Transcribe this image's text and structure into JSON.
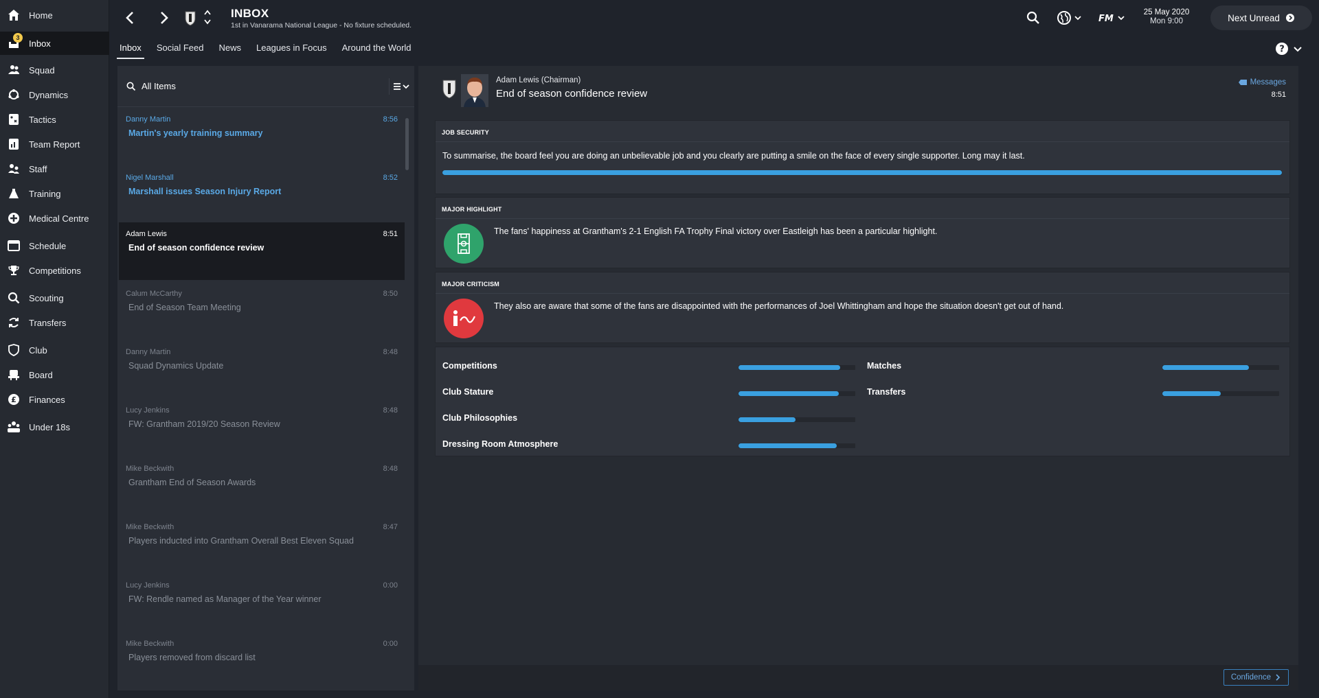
{
  "sidebar": {
    "items": [
      {
        "label": "Home",
        "icon": "home-icon"
      },
      {
        "label": "Inbox",
        "icon": "inbox-icon",
        "badge": "3"
      },
      {
        "label": "Squad",
        "icon": "squad-icon"
      },
      {
        "label": "Dynamics",
        "icon": "dynamics-icon"
      },
      {
        "label": "Tactics",
        "icon": "tactics-icon"
      },
      {
        "label": "Team Report",
        "icon": "team-report-icon"
      },
      {
        "label": "Staff",
        "icon": "staff-icon"
      },
      {
        "label": "Training",
        "icon": "training-icon"
      },
      {
        "label": "Medical Centre",
        "icon": "medical-icon"
      },
      {
        "label": "Schedule",
        "icon": "schedule-icon"
      },
      {
        "label": "Competitions",
        "icon": "trophy-icon"
      },
      {
        "label": "Scouting",
        "icon": "scouting-icon"
      },
      {
        "label": "Transfers",
        "icon": "transfers-icon"
      },
      {
        "label": "Club",
        "icon": "club-icon"
      },
      {
        "label": "Board",
        "icon": "board-icon"
      },
      {
        "label": "Finances",
        "icon": "finances-icon"
      },
      {
        "label": "Under 18s",
        "icon": "under18s-icon"
      }
    ]
  },
  "header": {
    "title": "INBOX",
    "subtitle": "1st in Vanarama National League - No fixture scheduled.",
    "date": "25 May 2020",
    "day_time": "Mon 9:00",
    "next_unread": "Next Unread"
  },
  "tabs": [
    "Inbox",
    "Social Feed",
    "News",
    "Leagues in Focus",
    "Around the World"
  ],
  "list": {
    "filter_label": "All Items",
    "messages": [
      {
        "sender": "Danny Martin",
        "time": "8:56",
        "subject": "Martin's yearly training summary",
        "state": "unread"
      },
      {
        "sender": "Nigel Marshall",
        "time": "8:52",
        "subject": "Marshall issues Season Injury Report",
        "state": "unread"
      },
      {
        "sender": "Adam Lewis",
        "time": "8:51",
        "subject": "End of season confidence review",
        "state": "selected"
      },
      {
        "sender": "Calum McCarthy",
        "time": "8:50",
        "subject": "End of Season Team Meeting",
        "state": "read"
      },
      {
        "sender": "Danny Martin",
        "time": "8:48",
        "subject": "Squad Dynamics Update",
        "state": "read"
      },
      {
        "sender": "Lucy Jenkins",
        "time": "8:48",
        "subject": "FW: Grantham 2019/20 Season Review",
        "state": "read"
      },
      {
        "sender": "Mike Beckwith",
        "time": "8:48",
        "subject": "Grantham End of Season Awards",
        "state": "read"
      },
      {
        "sender": "Mike Beckwith",
        "time": "8:47",
        "subject": "Players inducted into Grantham Overall Best Eleven Squad",
        "state": "read"
      },
      {
        "sender": "Lucy Jenkins",
        "time": "0:00",
        "subject": "FW: Rendle named as Manager of the Year winner",
        "state": "read"
      },
      {
        "sender": "Mike Beckwith",
        "time": "0:00",
        "subject": "Players removed from discard list",
        "state": "read"
      }
    ]
  },
  "detail": {
    "sender_line": "Adam Lewis  (Chairman)",
    "subject": "End of season confidence review",
    "messages_link": "Messages",
    "time": "8:51",
    "job_security": {
      "title": "JOB SECURITY",
      "text": "To summarise, the board feel you are doing an unbelievable job and you clearly are putting a smile on the face of every single supporter. Long may it last.",
      "level": 1.0
    },
    "highlight": {
      "title": "MAJOR HIGHLIGHT",
      "text": "The fans' happiness at Grantham's 2-1 English FA Trophy Final victory over Eastleigh has been a particular highlight.",
      "color": "#2fa36b"
    },
    "criticism": {
      "title": "MAJOR CRITICISM",
      "text": "They also are aware that some of the fans are disappointed with the performances of Joel Whittingham and hope the situation doesn't get out of hand.",
      "color": "#e0393e"
    },
    "ratings_left": [
      {
        "label": "Competitions",
        "value": 0.87
      },
      {
        "label": "Club Stature",
        "value": 0.86
      },
      {
        "label": "Club Philosophies",
        "value": 0.49
      },
      {
        "label": "Dressing Room Atmosphere",
        "value": 0.84
      }
    ],
    "ratings_right": [
      {
        "label": "Matches",
        "value": 0.74
      },
      {
        "label": "Transfers",
        "value": 0.5
      }
    ]
  },
  "footer": {
    "confidence_button": "Confidence"
  },
  "colors": {
    "accent": "#3aa0e0",
    "link": "#5aa9e6"
  }
}
